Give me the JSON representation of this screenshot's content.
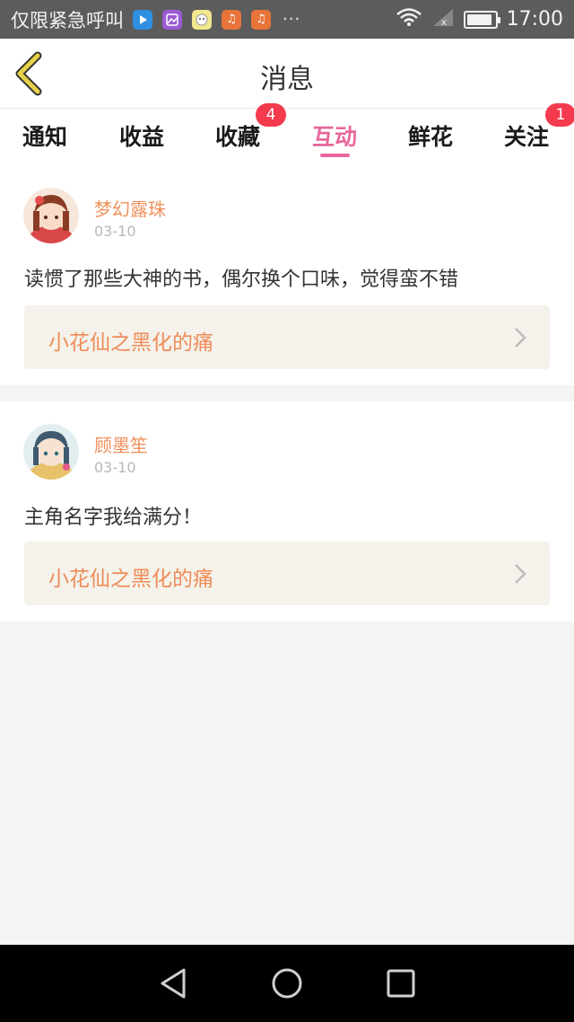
{
  "status_bar": {
    "carrier": "仅限紧急呼叫",
    "more": "···",
    "time": "17:00",
    "battery_level": 0.9
  },
  "header": {
    "title": "消息"
  },
  "tabs": [
    {
      "label": "通知",
      "badge": ""
    },
    {
      "label": "收益",
      "badge": ""
    },
    {
      "label": "收藏",
      "badge": "4"
    },
    {
      "label": "互动",
      "badge": "",
      "active": true
    },
    {
      "label": "鲜花",
      "badge": ""
    },
    {
      "label": "关注",
      "badge": "1"
    }
  ],
  "messages": [
    {
      "username": "梦幻露珠",
      "date": "03-10",
      "comment": "读惯了那些大神的书，偶尔换个口味，觉得蛮不错",
      "book_title": "小花仙之黑化的痛"
    },
    {
      "username": "顾墨笙",
      "date": "03-10",
      "comment": "主角名字我给满分！",
      "book_title": "小花仙之黑化的痛"
    }
  ],
  "colors": {
    "accent": "#e8679c",
    "username": "#f0905c",
    "badge": "#f43a4d",
    "back_arrow": "#c9a227"
  }
}
